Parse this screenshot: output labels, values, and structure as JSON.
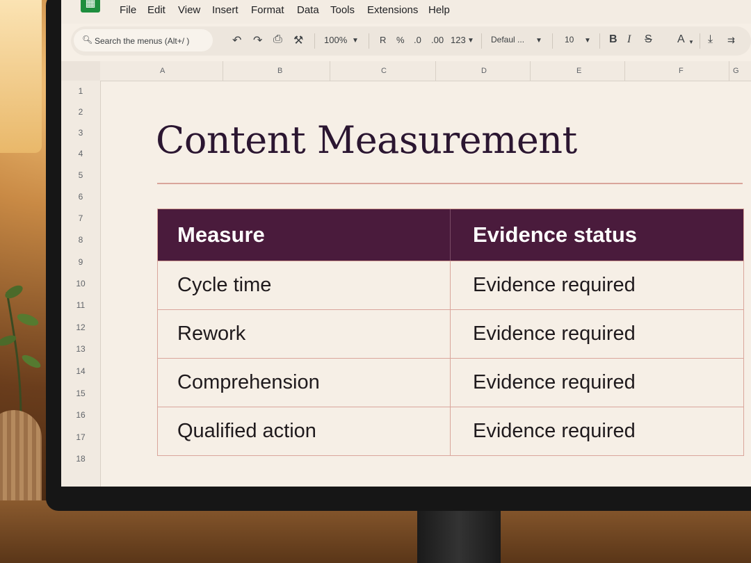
{
  "menubar": {
    "items": [
      "File",
      "Edit",
      "View",
      "Insert",
      "Format",
      "Data",
      "Tools",
      "Extensions",
      "Help"
    ]
  },
  "toolbar": {
    "search_placeholder": "Search the menus (Alt+/ )",
    "zoom": "100%",
    "currency": "R",
    "percent": "%",
    "decrease_decimal": ".0",
    "increase_decimal": ".00",
    "number_format": "123",
    "font_family": "Defaul ...",
    "font_size": "10",
    "bold": "B",
    "italic": "I",
    "strikethrough": "S",
    "text_color": "A"
  },
  "columns": [
    "A",
    "B",
    "C",
    "D",
    "E",
    "F",
    "G"
  ],
  "rows": [
    "1",
    "2",
    "3",
    "4",
    "5",
    "6",
    "7",
    "8",
    "9",
    "10",
    "11",
    "12",
    "13",
    "14",
    "15",
    "16",
    "17",
    "18"
  ],
  "sheet": {
    "title": "Content Measurement",
    "table": {
      "headers": [
        "Measure",
        "Evidence status"
      ],
      "rows": [
        [
          "Cycle time",
          "Evidence required"
        ],
        [
          "Rework",
          "Evidence required"
        ],
        [
          "Comprehension",
          "Evidence required"
        ],
        [
          "Qualified action",
          "Evidence required"
        ]
      ]
    }
  },
  "colors": {
    "header_bg": "#4a1b3c",
    "title": "#2b1631",
    "rule": "#d9a59b",
    "sheet_bg": "#f6efe6"
  }
}
